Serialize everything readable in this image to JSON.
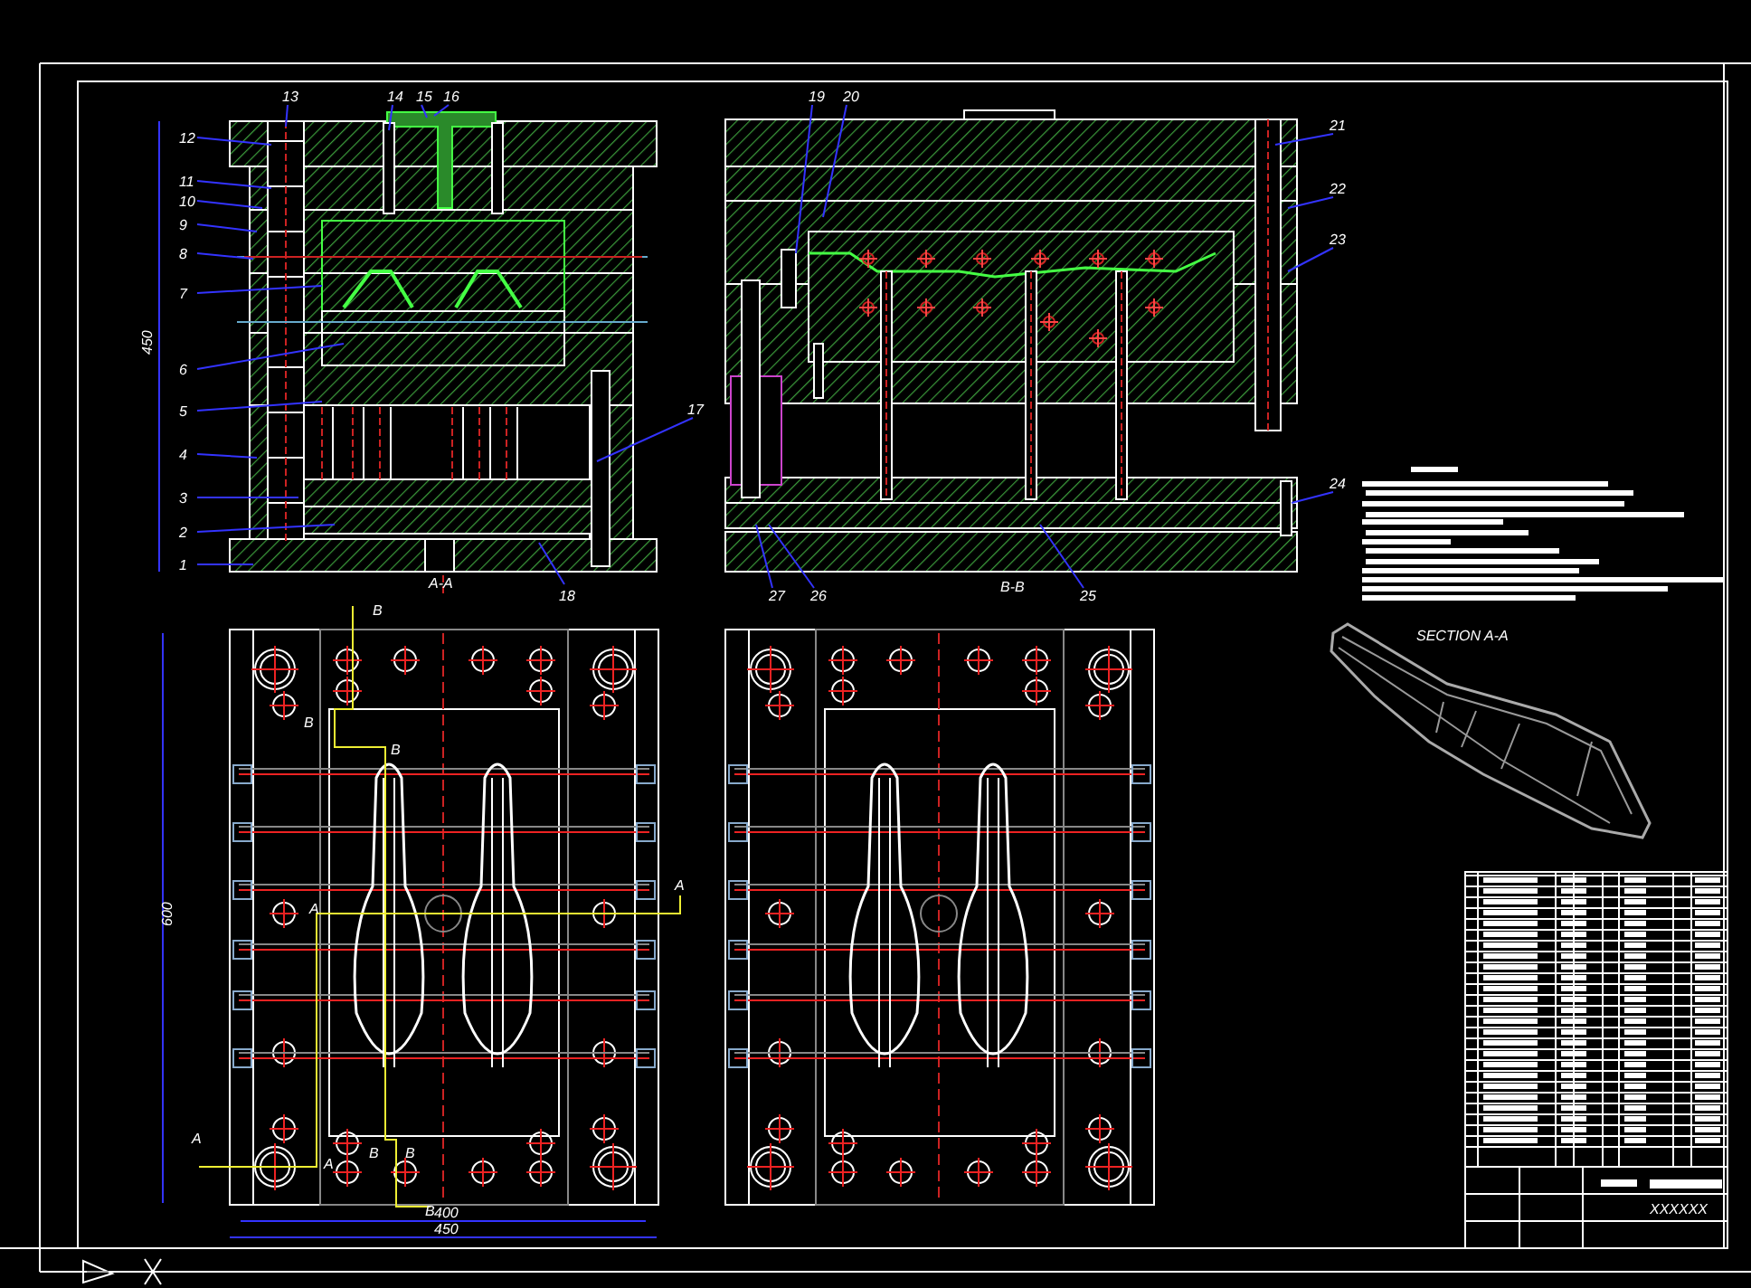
{
  "section_a": {
    "label": "A-A",
    "height_dim": "450",
    "callouts": [
      "12",
      "11",
      "10",
      "9",
      "8",
      "7",
      "6",
      "5",
      "4",
      "3",
      "2",
      "1",
      "13",
      "14",
      "15",
      "16",
      "17",
      "18"
    ]
  },
  "section_b": {
    "label": "B-B",
    "callouts": [
      "19",
      "20",
      "21",
      "22",
      "23",
      "24",
      "27",
      "26",
      "25"
    ]
  },
  "plan_view": {
    "dims": [
      "600",
      "400",
      "450"
    ],
    "section_marks": [
      "B",
      "B",
      "B",
      "A",
      "A",
      "A",
      "A",
      "B",
      "B",
      "B"
    ]
  },
  "iso_view": {
    "label": "SECTION A-A"
  },
  "title_block": {
    "code": "XXXXXX"
  }
}
